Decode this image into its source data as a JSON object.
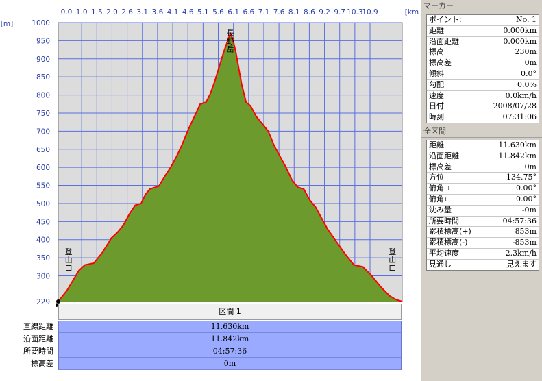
{
  "chart_data": {
    "type": "area",
    "xunit": "[km]",
    "yunit": "[m]",
    "x_ticks": [
      "0.0",
      "1.0",
      "1.5",
      "2.0",
      "2.6",
      "3.1",
      "3.6",
      "4.1",
      "4.6",
      "5.1",
      "5.6",
      "6.1",
      "6.6",
      "7.1",
      "7.6",
      "8.1",
      "8.6",
      "9.2",
      "9.7",
      "10.3",
      "10.9"
    ],
    "y_ticks": [
      1000,
      950,
      900,
      850,
      800,
      750,
      700,
      650,
      600,
      550,
      500,
      450,
      400,
      350,
      300
    ],
    "y_min_label": "229",
    "ylim": [
      229,
      1000
    ],
    "xlim": [
      0,
      11.63
    ],
    "fill_color": "#6d9a2c",
    "line_color": "#ff0000",
    "plot_bg": "#dcdcdc",
    "grid_color": "#5a70e0",
    "profile": {
      "x": [
        0.0,
        0.3,
        0.7,
        0.9,
        1.2,
        1.5,
        1.8,
        2.0,
        2.2,
        2.4,
        2.6,
        2.8,
        2.95,
        3.1,
        3.4,
        3.6,
        3.8,
        4.0,
        4.2,
        4.4,
        4.6,
        4.8,
        5.0,
        5.15,
        5.3,
        5.45,
        5.6,
        5.75,
        5.82,
        5.9,
        6.0,
        6.2,
        6.35,
        6.5,
        6.7,
        6.9,
        7.1,
        7.3,
        7.5,
        7.7,
        7.9,
        8.1,
        8.3,
        8.5,
        8.7,
        8.9,
        9.1,
        9.4,
        9.7,
        10.0,
        10.3,
        10.6,
        10.9,
        11.2,
        11.4,
        11.63
      ],
      "y": [
        229,
        260,
        315,
        330,
        335,
        365,
        405,
        420,
        440,
        470,
        495,
        500,
        525,
        540,
        548,
        575,
        600,
        630,
        665,
        705,
        740,
        775,
        780,
        805,
        840,
        880,
        920,
        955,
        970,
        955,
        920,
        830,
        780,
        770,
        740,
        720,
        700,
        660,
        630,
        600,
        565,
        545,
        540,
        510,
        490,
        460,
        430,
        395,
        360,
        330,
        325,
        300,
        270,
        245,
        235,
        229
      ]
    },
    "annotations": [
      {
        "text": "登山口",
        "x": 0.35,
        "y": 345
      },
      {
        "text": "長野岳",
        "x": 5.82,
        "y": 950
      },
      {
        "text": "登山口",
        "x": 11.3,
        "y": 345
      }
    ]
  },
  "section": {
    "label": "区間 1",
    "rows": [
      {
        "label": "直線距離",
        "value": "11.630km"
      },
      {
        "label": "沿面距離",
        "value": "11.842km"
      },
      {
        "label": "所要時間",
        "value": "04:57:36"
      },
      {
        "label": "標高差",
        "value": "0m"
      }
    ]
  },
  "marker": {
    "title": "マーカー",
    "rows": [
      {
        "label": "ポイント:",
        "value": "No. 1"
      },
      {
        "label": "距離",
        "value": "0.000km"
      },
      {
        "label": "沿面距離",
        "value": "0.000km"
      },
      {
        "label": "標高",
        "value": "230m"
      },
      {
        "label": "標高差",
        "value": "0m"
      },
      {
        "label": "傾斜",
        "value": "0.0°"
      },
      {
        "label": "勾配",
        "value": "0.0%"
      },
      {
        "label": "速度",
        "value": "0.0km/h"
      },
      {
        "label": "日付",
        "value": "2008/07/28"
      },
      {
        "label": "時刻",
        "value": "07:31:06"
      }
    ]
  },
  "whole": {
    "title": "全区間",
    "rows": [
      {
        "label": "距離",
        "value": "11.630km"
      },
      {
        "label": "沿面距離",
        "value": "11.842km"
      },
      {
        "label": "標高差",
        "value": "0m"
      },
      {
        "label": "方位",
        "value": "134.75°"
      },
      {
        "label": "俯角→",
        "value": "0.00°"
      },
      {
        "label": "俯角←",
        "value": "0.00°"
      },
      {
        "label": "沈み量",
        "value": "-0m"
      },
      {
        "label": "所要時間",
        "value": "04:57:36"
      },
      {
        "label": "累積標高(+)",
        "value": "853m"
      },
      {
        "label": "累積標高(-)",
        "value": "-853m"
      },
      {
        "label": "平均速度",
        "value": "2.3km/h"
      },
      {
        "label": "見通し",
        "value": "見えます"
      }
    ]
  }
}
